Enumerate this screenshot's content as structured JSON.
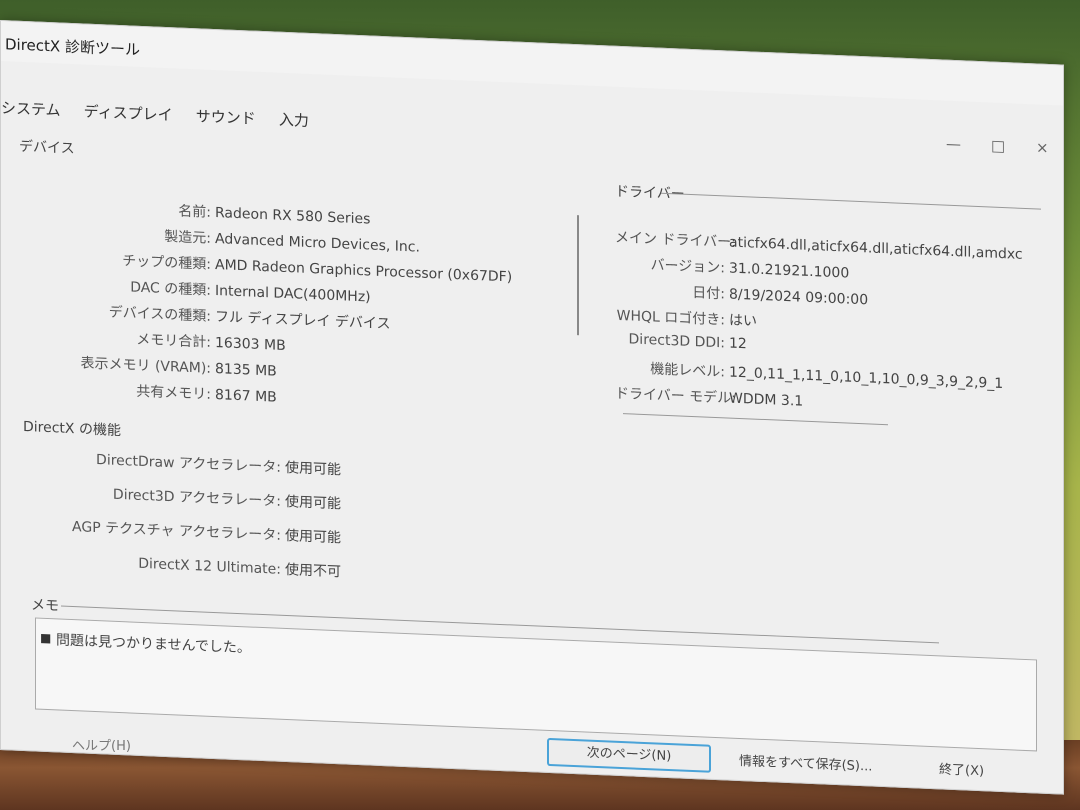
{
  "window": {
    "title": "DirectX 診断ツール",
    "minimize": "—",
    "maximize": "□",
    "close": "×"
  },
  "tabs": [
    "システム",
    "ディスプレイ",
    "サウンド",
    "入力"
  ],
  "device": {
    "label": "デバイス",
    "rows": [
      {
        "k": "名前:",
        "v": "Radeon RX 580 Series"
      },
      {
        "k": "製造元:",
        "v": "Advanced Micro Devices, Inc."
      },
      {
        "k": "チップの種類:",
        "v": "AMD Radeon Graphics Processor (0x67DF)"
      },
      {
        "k": "DAC の種類:",
        "v": "Internal DAC(400MHz)"
      },
      {
        "k": "デバイスの種類:",
        "v": "フル ディスプレイ デバイス"
      },
      {
        "k": "メモリ合計:",
        "v": "16303 MB"
      },
      {
        "k": "表示メモリ (VRAM):",
        "v": "8135 MB"
      },
      {
        "k": "共有メモリ:",
        "v": "8167 MB"
      }
    ]
  },
  "driver": {
    "label": "ドライバー",
    "rows": [
      {
        "k": "メイン ドライバー:",
        "v": "aticfx64.dll,aticfx64.dll,aticfx64.dll,amdxc"
      },
      {
        "k": "バージョン:",
        "v": "31.0.21921.1000"
      },
      {
        "k": "日付:",
        "v": "8/19/2024 09:00:00"
      },
      {
        "k": "WHQL ロゴ付き:",
        "v": "はい"
      },
      {
        "k": "Direct3D DDI:",
        "v": "12"
      },
      {
        "k": "機能レベル:",
        "v": "12_0,11_1,11_0,10_1,10_0,9_3,9_2,9_1"
      },
      {
        "k": "ドライバー モデル:",
        "v": "WDDM 3.1"
      }
    ]
  },
  "features": {
    "label": "DirectX の機能",
    "rows": [
      {
        "k": "DirectDraw アクセラレータ:",
        "v": "使用可能"
      },
      {
        "k": "Direct3D アクセラレータ:",
        "v": "使用可能"
      },
      {
        "k": "AGP テクスチャ アクセラレータ:",
        "v": "使用可能"
      },
      {
        "k": "DirectX 12 Ultimate:",
        "v": "使用不可"
      }
    ]
  },
  "notes": {
    "label": "メモ",
    "items": [
      "問題は見つかりませんでした。"
    ]
  },
  "buttons": {
    "next": "次のページ(N)",
    "save": "情報をすべて保存(S)...",
    "exit": "終了(X)",
    "help": "ヘルプ(H)"
  }
}
